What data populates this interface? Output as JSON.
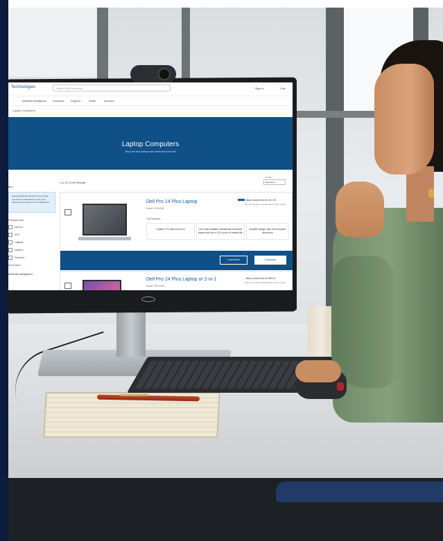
{
  "screen": {
    "header": {
      "brand": "Technologies",
      "search_placeholder": "Search Dell Products",
      "sign_in": "Sign In",
      "cart": "Cart"
    },
    "nav": [
      "Artificial Intelligence",
      "Solutions",
      "Support",
      "Deals",
      "Account"
    ],
    "breadcrumb": "Laptop Computers",
    "hero": {
      "title": "Laptop Computers",
      "subtitle": "Shop the best laptops and notebooks from Dell"
    },
    "results_count": "1 to 12 of 44 Results",
    "sort": {
      "label": "Sort By",
      "value": "Relevance"
    },
    "filters": {
      "title": "ters",
      "note": "Selecting filter(s) will refresh the results and show models which contain your selections as options in the configuration.",
      "product_line": {
        "label": "Product Line",
        "options": [
          "Dell Pro",
          "XPS",
          "Latitude",
          "Inspiron",
          "Precision"
        ],
        "show_more": "Show More"
      },
      "ai_group": {
        "label": "Artificial Intelligence"
      }
    },
    "products": [
      {
        "title": "Dell Pro 14 Plus Laptop",
        "model": "Model: PB14250",
        "features_heading": "Top Features",
        "features": [
          "Copilot+ PC with built-in AI",
          "Our most scalable mainstream business laptop with up to 13.3 hours of battery life",
          "Durable design with 20% recycled aluminum"
        ],
        "price_label": "Base model from $1,047.99",
        "price_sub": "Price of the base configuration of this model.",
        "learn_more": "Learn More",
        "customize": "Customize"
      },
      {
        "title": "Dell Pro 14 Plus Laptop or 2-in-1",
        "model": "Model: PB14255",
        "price_label": "Base model from $1,089.07",
        "price_sub": "Price of the base configuration of this model."
      }
    ]
  }
}
